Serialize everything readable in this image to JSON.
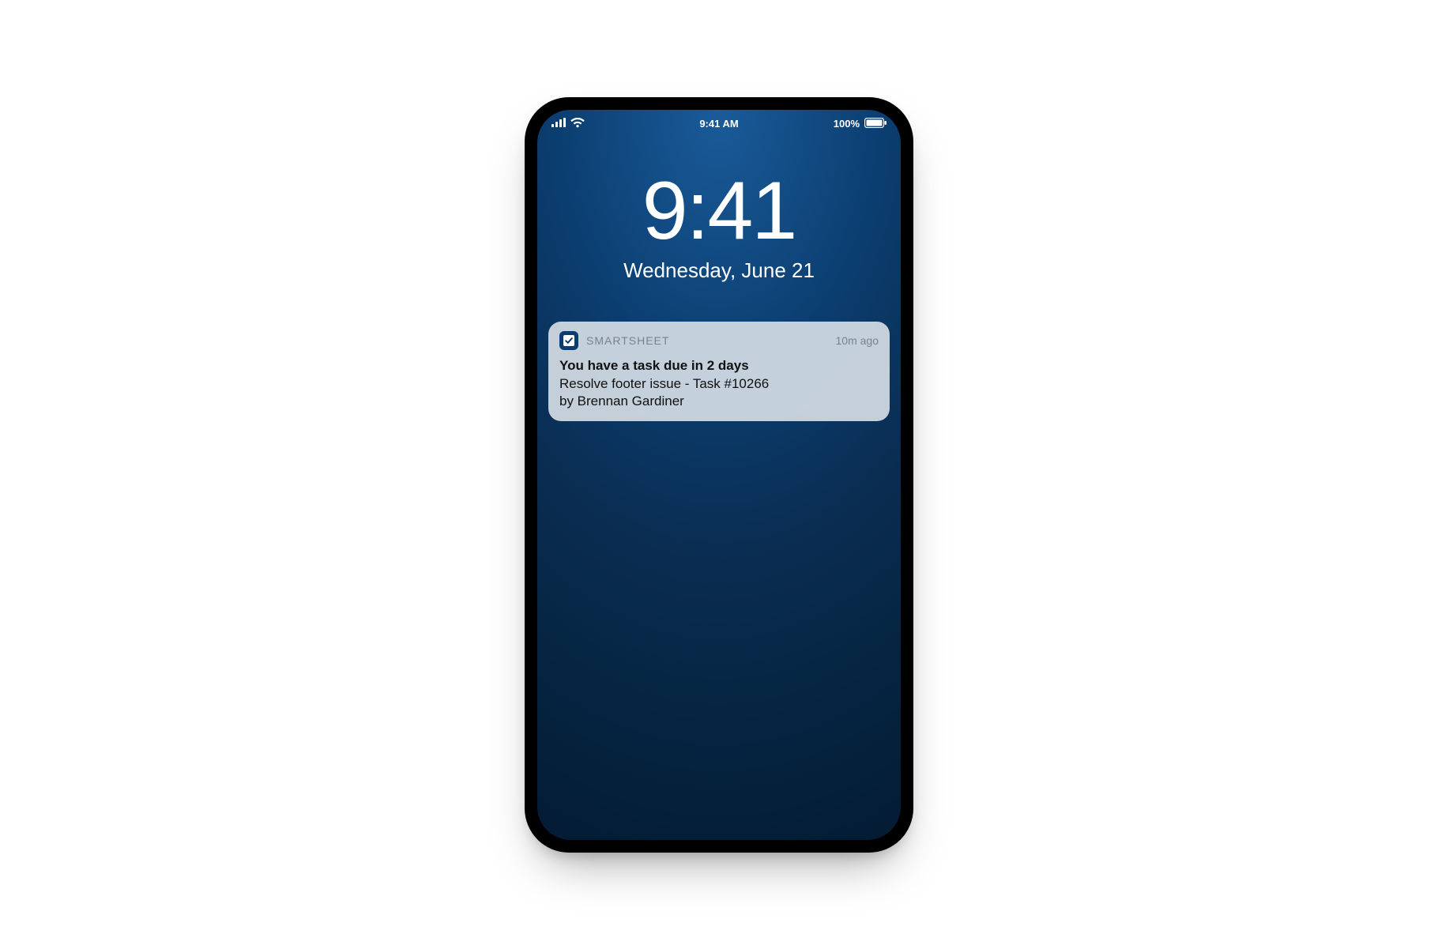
{
  "status_bar": {
    "time": "9:41 AM",
    "battery_text": "100%",
    "signal_icon": "signal-icon",
    "wifi_icon": "wifi-icon",
    "battery_icon": "battery-icon"
  },
  "lock_screen": {
    "time": "9:41",
    "date": "Wednesday, June 21"
  },
  "notification": {
    "app_name": "SMARTSHEET",
    "app_icon": "smartsheet-check-icon",
    "timestamp": "10m ago",
    "title": "You have a task due in 2 days",
    "line1": "Resolve footer issue - Task #10266",
    "line2": "by Brennan Gardiner"
  },
  "colors": {
    "brand_blue": "#0b3e70",
    "card_bg": "rgba(222,229,234,0.88)",
    "muted_text": "#7a838c"
  }
}
